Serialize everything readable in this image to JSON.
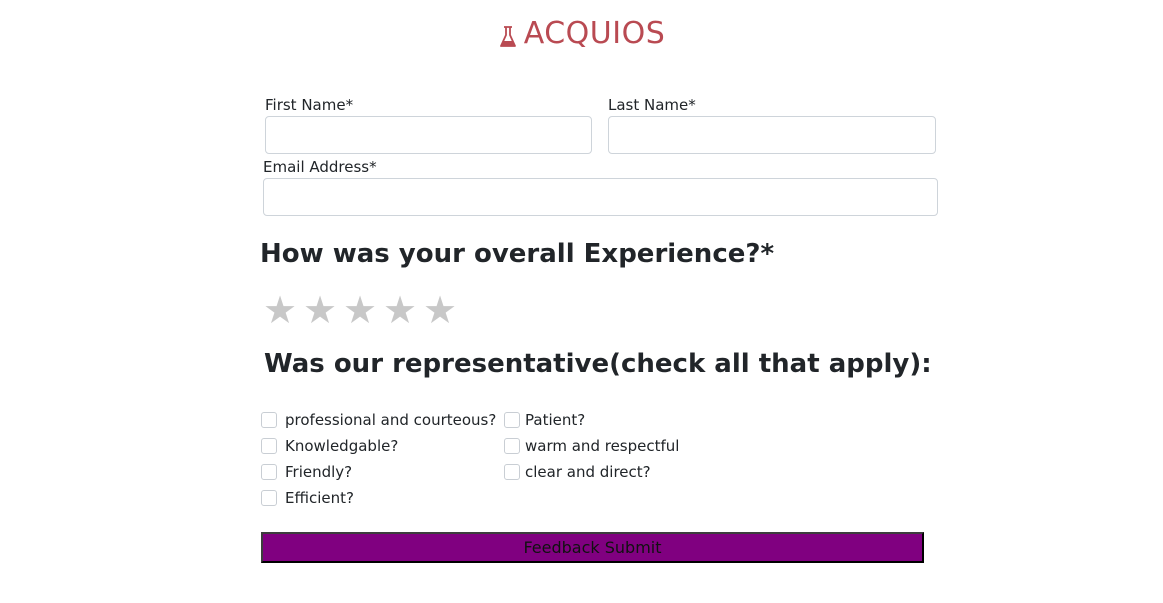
{
  "brand": {
    "name": "ACQUIOS",
    "icon": "flask-icon",
    "color": "#b94a52"
  },
  "form": {
    "first_name": {
      "label": "First Name*",
      "value": "",
      "placeholder": ""
    },
    "last_name": {
      "label": "Last Name*",
      "value": "",
      "placeholder": ""
    },
    "email": {
      "label": "Email Address*",
      "value": "",
      "placeholder": ""
    }
  },
  "rating": {
    "question": "How was your overall Experience?*",
    "max_stars": 5,
    "selected": 0,
    "star_glyph": "★",
    "star_color": "#c8c8c8"
  },
  "representative": {
    "question": "Was our representative(check all that apply):",
    "options_left": [
      {
        "label": "professional and courteous?",
        "checked": false
      },
      {
        "label": "Knowledgable?",
        "checked": false
      },
      {
        "label": "Friendly?",
        "checked": false
      },
      {
        "label": "Efficient?",
        "checked": false
      }
    ],
    "options_right": [
      {
        "label": "Patient?",
        "checked": false
      },
      {
        "label": "warm and respectful",
        "checked": false
      },
      {
        "label": "clear and direct?",
        "checked": false
      }
    ]
  },
  "submit": {
    "label": "Feedback Submit",
    "color": "#800080"
  }
}
